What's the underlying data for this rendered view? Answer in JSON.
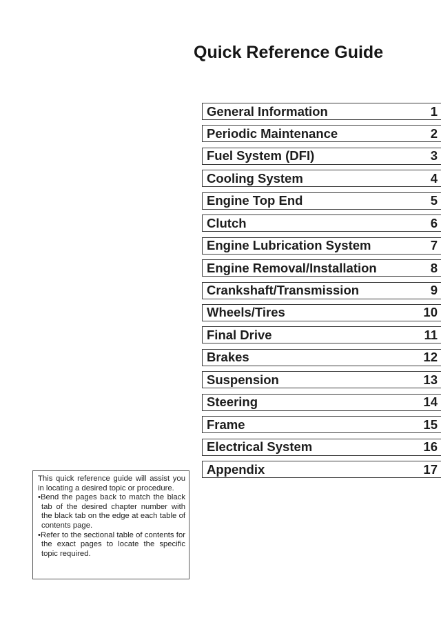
{
  "page": {
    "title": "Quick Reference Guide"
  },
  "toc": [
    {
      "label": "General Information",
      "number": "1"
    },
    {
      "label": "Periodic Maintenance",
      "number": "2"
    },
    {
      "label": "Fuel System (DFI)",
      "number": "3"
    },
    {
      "label": "Cooling System",
      "number": "4"
    },
    {
      "label": "Engine Top End",
      "number": "5"
    },
    {
      "label": "Clutch",
      "number": "6"
    },
    {
      "label": "Engine Lubrication System",
      "number": "7"
    },
    {
      "label": "Engine Removal/Installation",
      "number": "8"
    },
    {
      "label": "Crankshaft/Transmission",
      "number": "9"
    },
    {
      "label": "Wheels/Tires",
      "number": "10"
    },
    {
      "label": "Final Drive",
      "number": "11"
    },
    {
      "label": "Brakes",
      "number": "12"
    },
    {
      "label": "Suspension",
      "number": "13"
    },
    {
      "label": "Steering",
      "number": "14"
    },
    {
      "label": "Frame",
      "number": "15"
    },
    {
      "label": "Electrical System",
      "number": "16"
    },
    {
      "label": "Appendix",
      "number": "17"
    }
  ],
  "info_box": {
    "intro": "This quick reference guide will assist you in locating a desired topic or procedure.",
    "bullets": [
      "•Bend the pages back to match the black tab of the desired chapter number with the black tab on the edge at each table of contents page.",
      "•Refer to the sectional table of contents for the exact pages to locate the specific topic required."
    ]
  }
}
